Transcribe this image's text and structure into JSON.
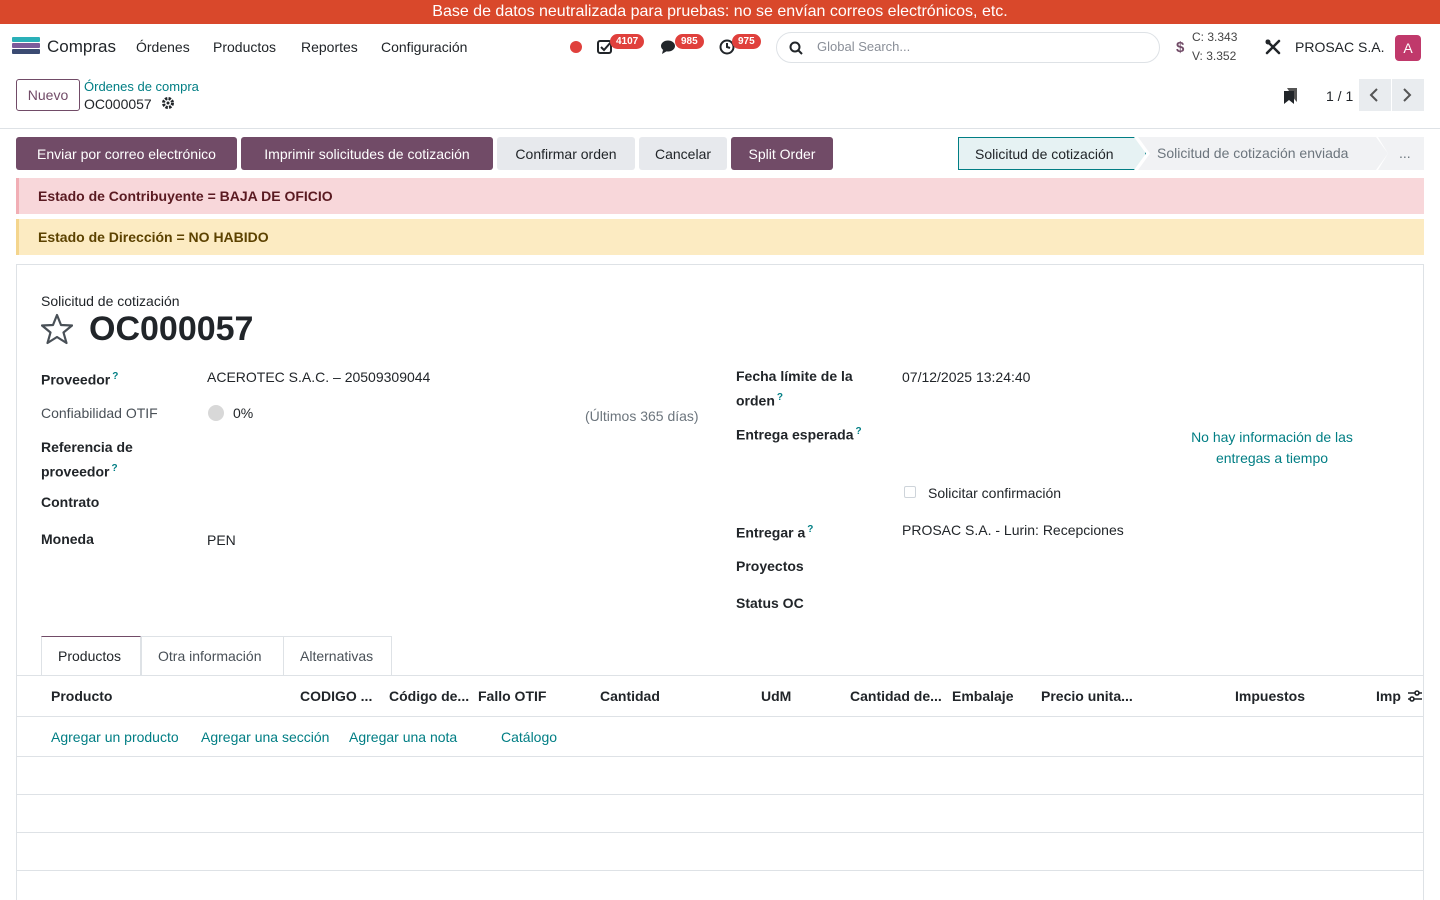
{
  "banner": "Base de datos neutralizada para pruebas: no se envían correos electrónicos, etc.",
  "app": {
    "name": "Compras"
  },
  "menu": [
    "Órdenes",
    "Productos",
    "Reportes",
    "Configuración"
  ],
  "systray": {
    "activities": "4107",
    "messages": "985",
    "timers": "975"
  },
  "search": {
    "placeholder": "Global Search..."
  },
  "rates": {
    "symbol": "$",
    "buy": "C: 3.343",
    "sell": "V: 3.352"
  },
  "company": "PROSAC S.A.",
  "user": {
    "initial": "A"
  },
  "control": {
    "new_label": "Nuevo",
    "breadcrumb_parent": "Órdenes de compra",
    "breadcrumb_current": "OC000057",
    "pager": "1 / 1"
  },
  "actions": {
    "send_email": "Enviar por correo electrónico",
    "print_rfq": "Imprimir solicitudes de cotización",
    "confirm": "Confirmar orden",
    "cancel": "Cancelar",
    "split": "Split Order"
  },
  "status": {
    "active": "Solicitud de cotización",
    "next": "Solicitud de cotización enviada",
    "more": "..."
  },
  "alerts": {
    "danger": "Estado de Contribuyente = BAJA DE OFICIO",
    "warning": "Estado de Dirección = NO HABIDO"
  },
  "form": {
    "doc_type": "Solicitud de cotización",
    "doc_name": "OC000057",
    "help_mark": "?",
    "left": {
      "vendor_label": "Proveedor",
      "vendor_value": "ACEROTEC S.A.C. – 20509309044",
      "otif_label": "Confiabilidad OTIF",
      "otif_value": "0%",
      "otif_hint": "(Últimos 365 días)",
      "ref_label_1": "Referencia de",
      "ref_label_2": "proveedor",
      "contract_label": "Contrato",
      "currency_label": "Moneda",
      "currency_value": "PEN"
    },
    "right": {
      "deadline_label_1": "Fecha límite de la",
      "deadline_label_2": "orden",
      "deadline_value": "07/12/2025 13:24:40",
      "expected_label": "Entrega esperada",
      "no_info_1": "No hay información de las",
      "no_info_2": "entregas a tiempo",
      "ask_confirm": "Solicitar confirmación",
      "deliver_label": "Entregar a",
      "deliver_value": "PROSAC S.A. - Lurin: Recepciones",
      "projects_label": "Proyectos",
      "status_label": "Status OC"
    }
  },
  "tabs": [
    "Productos",
    "Otra información",
    "Alternativas"
  ],
  "columns": [
    "Producto",
    "CODIGO ...",
    "Código de...",
    "Fallo OTIF",
    "Cantidad",
    "UdM",
    "Cantidad de...",
    "Embalaje",
    "Precio unita...",
    "Impuestos",
    "Imp"
  ],
  "line_actions": [
    "Agregar un producto",
    "Agregar una sección",
    "Agregar una nota",
    "Catálogo"
  ]
}
